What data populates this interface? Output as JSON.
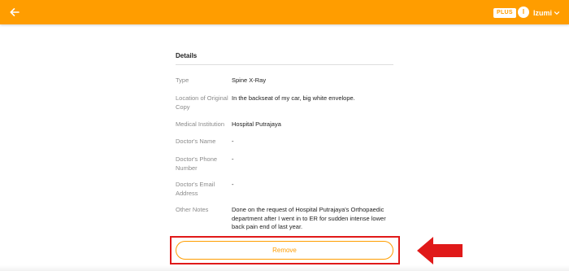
{
  "header": {
    "bg_color": "#FF9D00",
    "back_icon": "arrow-left-icon",
    "plus_badge": "PLUS",
    "avatar_initial": "I",
    "user_name": "Izumi",
    "dropdown_icon": "chevron-down-icon"
  },
  "details": {
    "title": "Details",
    "rows": [
      {
        "label": "Type",
        "value": "Spine X-Ray"
      },
      {
        "label": "Location of Original Copy",
        "value": "In the backseat of my car, big white envelope."
      },
      {
        "label": "Medical Institution",
        "value": "Hospital Putrajaya"
      },
      {
        "label": "Doctor's Name",
        "value": "-"
      },
      {
        "label": "Doctor's Phone Number",
        "value": "-"
      },
      {
        "label": "Doctor's Email Address",
        "value": "-"
      },
      {
        "label": "Other Notes",
        "value": "Done on the request of Hospital Putrajaya's Orthopaedic department after I went in to ER for sudden intense lower back pain end of last year."
      }
    ]
  },
  "actions": {
    "remove_label": "Remove",
    "accent_color": "#FF9D00",
    "annotation_color": "#E01919"
  }
}
